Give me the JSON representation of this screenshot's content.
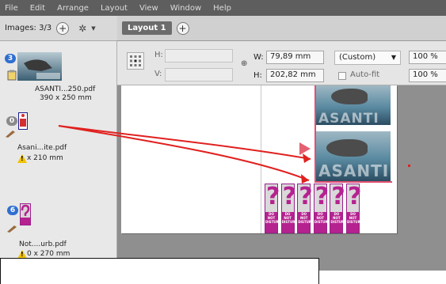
{
  "menu": [
    "File",
    "Edit",
    "Arrange",
    "Layout",
    "View",
    "Window",
    "Help"
  ],
  "images_bar": {
    "label": "Images: 3/3",
    "add_symbol": "+",
    "gear_icon": "gear-icon",
    "caret": "▼"
  },
  "layout_tabs": {
    "active_tab": "Layout 1",
    "add_symbol": "+"
  },
  "images": [
    {
      "badge": "3",
      "badge_color": "#2f6fcf",
      "filename": "ASANTI...250.pdf",
      "size": "390 x 250 mm",
      "warning": false
    },
    {
      "badge": "0",
      "badge_color": "#8a8a8a",
      "filename": "Asani...ite.pdf",
      "size": "x 210 mm",
      "warning": true
    },
    {
      "badge": "6",
      "badge_color": "#2f6fcf",
      "filename": "Not....urb.pdf",
      "size": "0 x 270 mm",
      "warning": true
    }
  ],
  "dimensions": {
    "h_label": "H:",
    "v_label": "V:",
    "w_label": "W:",
    "w_value": "79,89 mm",
    "h2_label": "H:",
    "h2_value": "202,82 mm",
    "preset": "(Custom)",
    "autofit_label": "Auto-fit",
    "scale_w": "100 %",
    "scale_h": "100 %"
  },
  "artwork_text": "ASANTI",
  "hanger_text": "DO NOT DISTURB",
  "hanger_count": 6,
  "colors": {
    "menubar": "#5e5e5e",
    "accent_magenta": "#b5228f",
    "arrow_red": "#e0211f"
  }
}
